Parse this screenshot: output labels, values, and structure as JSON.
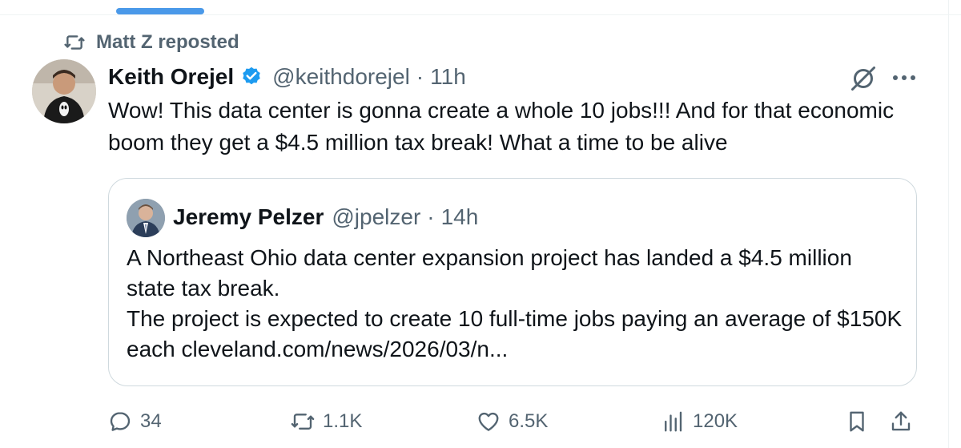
{
  "repost_banner": {
    "label": "Matt Z reposted",
    "icon": "repost-icon"
  },
  "tweet": {
    "author_name": "Keith Orejel",
    "handle": "@keithdorejel",
    "separator": "·",
    "time": "11h",
    "verified_color": "#1d9bf0",
    "text": "Wow! This data center is gonna create a whole 10 jobs!!! And for that economic boom they get a $4.5 million tax break! What a time to be alive"
  },
  "quote": {
    "author_name": "Jeremy Pelzer",
    "handle": "@jpelzer",
    "separator": "·",
    "time": "14h",
    "text_line1": "A Northeast Ohio data center expansion project has landed a $4.5 million state tax break.",
    "text_line2": "The project is expected to create 10 full-time jobs paying an average of $150K each cleveland.com/news/2026/03/n..."
  },
  "actions": {
    "replies": "34",
    "reposts": "1.1K",
    "likes": "6.5K",
    "views": "120K"
  },
  "colors": {
    "accent": "#1d9bf0",
    "secondary_text": "#536471",
    "tab_indicator": "#4a99e9",
    "border": "#cfd9de"
  }
}
